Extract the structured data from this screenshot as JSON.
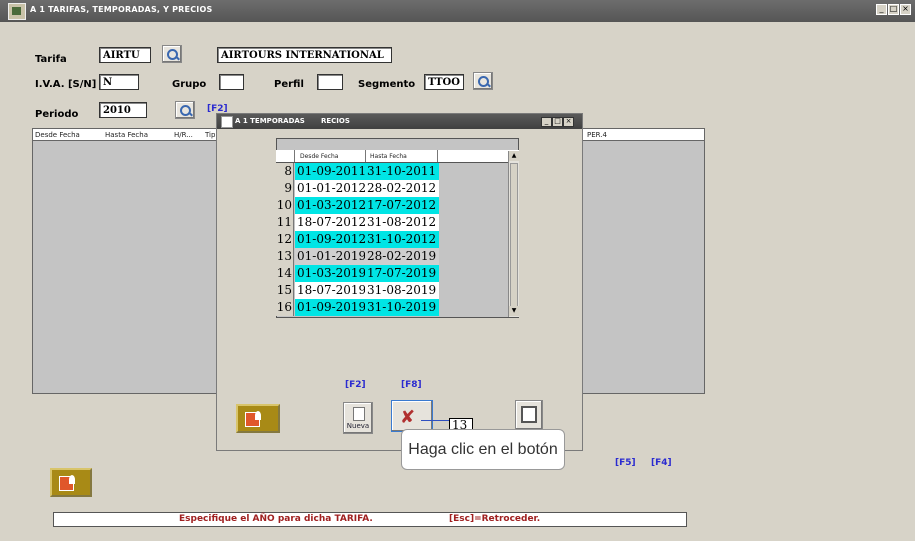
{
  "window": {
    "title": "A 1 TARIFAS, TEMPORADAS, Y PRECIOS",
    "controls": [
      "_",
      "□",
      "×"
    ]
  },
  "form": {
    "tarifa_label": "Tarifa",
    "tarifa_code": "AIRTU",
    "tarifa_name": "AIRTOURS INTERNATIONAL",
    "iva_label": "I.V.A. [S/N]",
    "iva_value": "N",
    "grupo_label": "Grupo",
    "grupo_value": "",
    "perfil_label": "Perfil",
    "perfil_value": "",
    "segmento_label": "Segmento",
    "segmento_value": "TTOO",
    "periodo_label": "Periodo",
    "periodo_value": "2010",
    "f2_label": "[F2]"
  },
  "grid": {
    "columns": [
      "Desde Fecha",
      "Hasta Fecha",
      "H/R...",
      "Tip"
    ],
    "per4": "PER.4"
  },
  "dialog": {
    "title": "A 1 TEMPORADAS",
    "title_suffix": "RECIOS",
    "controls": [
      "_",
      "□",
      "×"
    ],
    "columns": [
      "Desde Fecha",
      "Hasta Fecha"
    ],
    "rows": [
      {
        "n": "8",
        "desde": "01-09-2011",
        "hasta": "31-10-2011",
        "style": "cyan"
      },
      {
        "n": "9",
        "desde": "01-01-2012",
        "hasta": "28-02-2012",
        "style": "white"
      },
      {
        "n": "10",
        "desde": "01-03-2012",
        "hasta": "17-07-2012",
        "style": "cyan"
      },
      {
        "n": "11",
        "desde": "18-07-2012",
        "hasta": "31-08-2012",
        "style": "white"
      },
      {
        "n": "12",
        "desde": "01-09-2012",
        "hasta": "31-10-2012",
        "style": "cyan"
      },
      {
        "n": "13",
        "desde": "01-01-2019",
        "hasta": "28-02-2019",
        "style": "grey"
      },
      {
        "n": "14",
        "desde": "01-03-2019",
        "hasta": "17-07-2019",
        "style": "cyan"
      },
      {
        "n": "15",
        "desde": "18-07-2019",
        "hasta": "31-08-2019",
        "style": "white"
      },
      {
        "n": "16",
        "desde": "01-09-2019",
        "hasta": "31-10-2019",
        "style": "cyan"
      }
    ],
    "f2_label": "[F2]",
    "f8_label": "[F8]",
    "nueva_label": "Nueva",
    "row_counter": "13"
  },
  "fkeys": {
    "f5": "[F5]",
    "f4": "[F4]"
  },
  "tooltip": "Haga clic en el botón",
  "status": {
    "message": "Especifique el AÑO para dicha TARIFA.",
    "hint": "[Esc]=Retroceder."
  },
  "colors": {
    "cyan_row": "#00e5e5",
    "white_row": "#ffffff",
    "grey_row": "#cfcfcf",
    "fkey": "#2b2bd0",
    "status_text": "#a02020"
  }
}
